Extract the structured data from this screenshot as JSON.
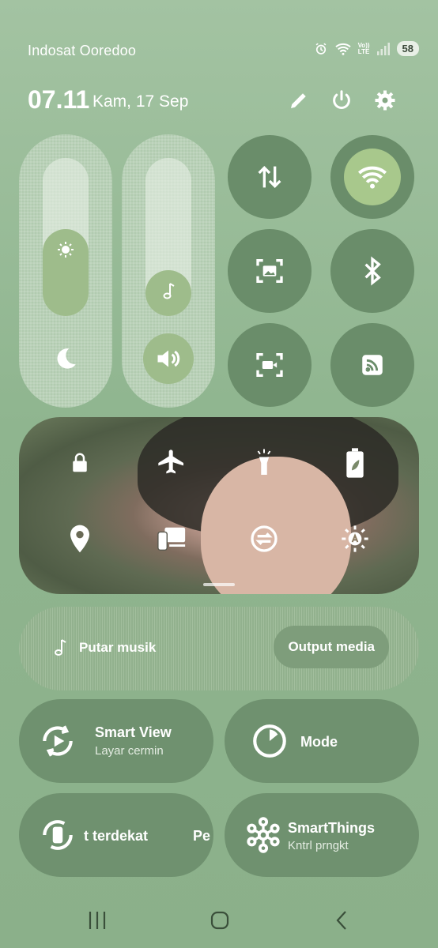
{
  "status_bar": {
    "carrier": "Indosat Ooredoo",
    "battery": "58",
    "network_top": "Vo))",
    "network_bottom": "LTE",
    "icons": [
      "alarm-icon",
      "wifi-icon",
      "signal-icon"
    ]
  },
  "header": {
    "time": "07.11",
    "date": "Kam, 17 Sep",
    "icons": [
      "edit-icon",
      "power-icon",
      "settings-icon"
    ]
  },
  "sliders": {
    "brightness_level": 0.55,
    "volume_level": 0.17,
    "brightness_icon": "sun-icon",
    "night_icon": "moon-icon",
    "music_icon": "music-note-icon",
    "volume_icon": "volume-icon"
  },
  "toggles": [
    {
      "name": "mobile-data",
      "icon": "data-arrows-icon",
      "active": false
    },
    {
      "name": "wifi",
      "icon": "wifi-icon",
      "active": true
    },
    {
      "name": "screenshot",
      "icon": "screenshot-icon",
      "active": false
    },
    {
      "name": "bluetooth",
      "icon": "bluetooth-icon",
      "active": false
    },
    {
      "name": "screen-recorder",
      "icon": "screen-record-icon",
      "active": false
    },
    {
      "name": "cast",
      "icon": "cast-icon",
      "active": false
    }
  ],
  "quick_grid": [
    "lock-icon",
    "airplane-icon",
    "flashlight-icon",
    "battery-saver-icon",
    "location-icon",
    "device-link-icon",
    "sync-icon",
    "brightness-auto-icon"
  ],
  "media": {
    "label": "Putar musik",
    "output_button": "Output media"
  },
  "tiles": {
    "smart_view": {
      "title": "Smart View",
      "subtitle": "Layar cermin"
    },
    "mode": {
      "title": "Mode"
    },
    "nearby": {
      "title": "t terdekat",
      "overflow": "Pe"
    },
    "smartthings": {
      "title": "SmartThings",
      "subtitle": "Kntrl prngkt"
    }
  },
  "nav": [
    "recents-icon",
    "home-icon",
    "back-icon"
  ]
}
